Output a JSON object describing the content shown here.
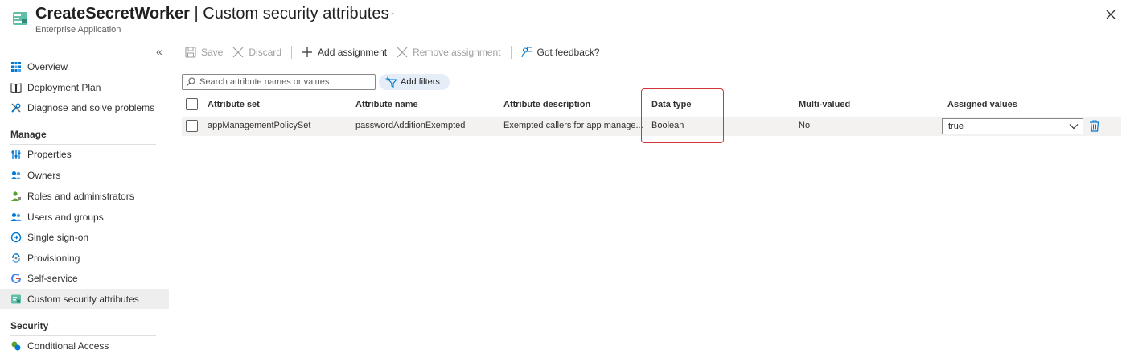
{
  "header": {
    "app_name": "CreateSecretWorker",
    "separator": " | ",
    "page_name": "Custom security attributes",
    "subtitle": "Enterprise Application",
    "more_label": "···",
    "collapse_label": "«"
  },
  "sidebar": {
    "items": [
      {
        "label": "Overview",
        "icon": "grid-icon"
      },
      {
        "label": "Deployment Plan",
        "icon": "book-icon"
      },
      {
        "label": "Diagnose and solve problems",
        "icon": "wrench-icon"
      }
    ],
    "sections": [
      {
        "title": "Manage",
        "items": [
          {
            "label": "Properties",
            "icon": "sliders-icon"
          },
          {
            "label": "Owners",
            "icon": "people-icon"
          },
          {
            "label": "Roles and administrators",
            "icon": "person-key-icon"
          },
          {
            "label": "Users and groups",
            "icon": "people-icon"
          },
          {
            "label": "Single sign-on",
            "icon": "sso-icon"
          },
          {
            "label": "Provisioning",
            "icon": "sync-icon"
          },
          {
            "label": "Self-service",
            "icon": "google-g-icon"
          },
          {
            "label": "Custom security attributes",
            "icon": "attribute-icon",
            "active": true
          }
        ]
      },
      {
        "title": "Security",
        "items": [
          {
            "label": "Conditional Access",
            "icon": "conditional-access-icon"
          }
        ]
      }
    ]
  },
  "toolbar": {
    "save_label": "Save",
    "discard_label": "Discard",
    "add_assignment_label": "Add assignment",
    "remove_assignment_label": "Remove assignment",
    "feedback_label": "Got feedback?"
  },
  "search": {
    "placeholder": "Search attribute names or values"
  },
  "filters": {
    "add_filters_label": "Add filters"
  },
  "table": {
    "columns": [
      "Attribute set",
      "Attribute name",
      "Attribute description",
      "Data type",
      "Multi-valued",
      "Assigned values"
    ],
    "rows": [
      {
        "attribute_set": "appManagementPolicySet",
        "attribute_name": "passwordAdditionExempted",
        "attribute_description": "Exempted callers for app manage...",
        "data_type": "Boolean",
        "multi_valued": "No",
        "assigned_value": "true"
      }
    ]
  },
  "colors": {
    "accent": "#0078d4",
    "highlight": "#d13438",
    "active_nav": "#eeeeee",
    "row_bg": "#f3f2f1"
  }
}
